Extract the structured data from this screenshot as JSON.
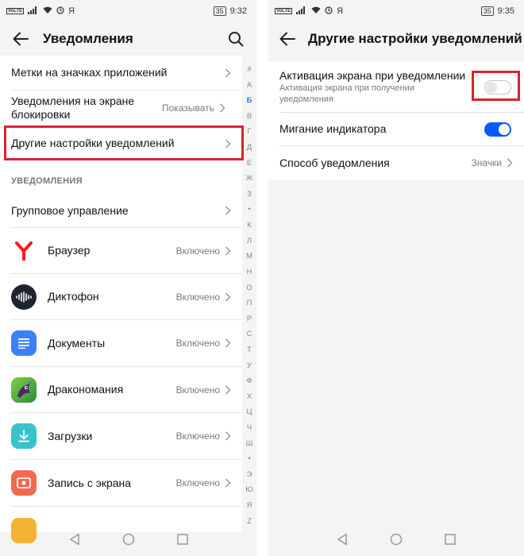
{
  "left": {
    "status": {
      "time": "9:32",
      "battery": "35",
      "carrier": "VoLTE",
      "ya": "Я"
    },
    "appbar": {
      "title": "Уведомления"
    },
    "settings": [
      {
        "label": "Метки на значках приложений",
        "value": ""
      },
      {
        "label": "Уведомления на экране блокировки",
        "value": "Показывать"
      },
      {
        "label": "Другие настройки уведомлений",
        "value": ""
      }
    ],
    "section_title": "УВЕДОМЛЕНИЯ",
    "group_label": "Групповое управление",
    "apps": [
      {
        "name": "Браузер",
        "status": "Включено",
        "icon": "yandex-browser-icon"
      },
      {
        "name": "Диктофон",
        "status": "Включено",
        "icon": "recorder-icon"
      },
      {
        "name": "Документы",
        "status": "Включено",
        "icon": "documents-icon"
      },
      {
        "name": "Дракономания",
        "status": "Включено",
        "icon": "dragon-game-icon"
      },
      {
        "name": "Загрузки",
        "status": "Включено",
        "icon": "downloads-icon"
      },
      {
        "name": "Запись с экрана",
        "status": "Включено",
        "icon": "screen-record-icon"
      }
    ],
    "alphabet": [
      "#",
      "А",
      "Б",
      "В",
      "Г",
      "Д",
      "Е",
      "Ж",
      "З",
      "•",
      "К",
      "Л",
      "М",
      "Н",
      "О",
      "П",
      "Р",
      "С",
      "Т",
      "У",
      "Ф",
      "Х",
      "Ц",
      "Ч",
      "Ш",
      "•",
      "Э",
      "Ю",
      "Я",
      "Z"
    ],
    "alphabet_active": "Б"
  },
  "right": {
    "status": {
      "time": "9:35",
      "battery": "35",
      "carrier": "VoLTE",
      "ya": "Я"
    },
    "appbar": {
      "title": "Другие настройки уведомлений"
    },
    "wake": {
      "label": "Активация экрана при уведомлении",
      "sub": "Активация экрана при получении уведомления",
      "on": false
    },
    "blink": {
      "label": "Мигание индикатора",
      "on": true
    },
    "method": {
      "label": "Способ уведомления",
      "value": "Значки"
    }
  },
  "colors": {
    "accent": "#0a59f7",
    "highlight": "#d8232a",
    "yandex": "#ff0000"
  }
}
